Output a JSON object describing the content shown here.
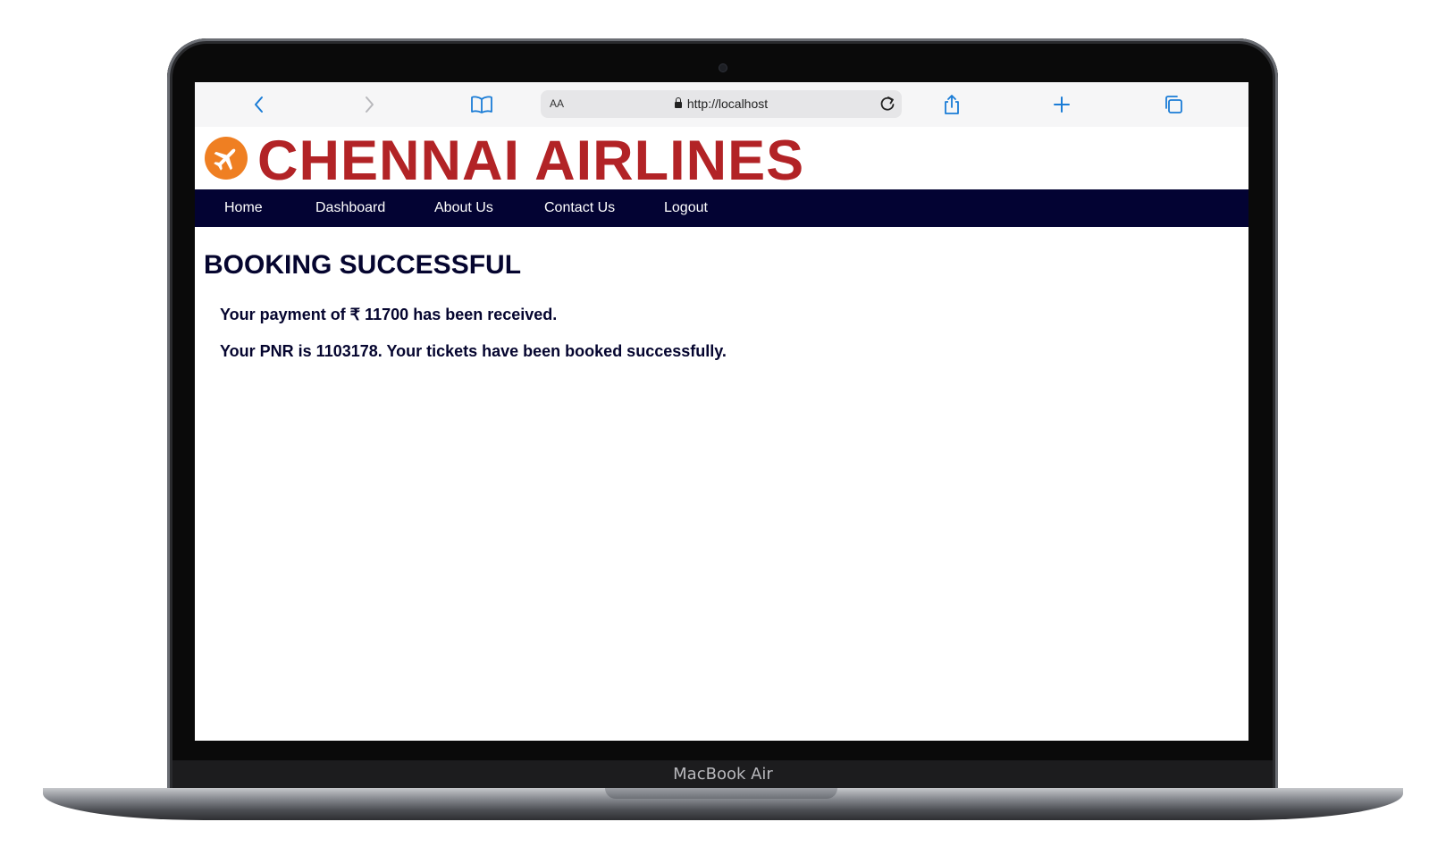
{
  "browser": {
    "text_size_label": "AA",
    "url": "http://localhost"
  },
  "site": {
    "title": "CHENNAI AIRLINES",
    "brand_color": "#b22326",
    "logo_color": "#ef7f22"
  },
  "nav": {
    "items": [
      {
        "label": "Home"
      },
      {
        "label": "Dashboard"
      },
      {
        "label": "About Us"
      },
      {
        "label": "Contact Us"
      },
      {
        "label": "Logout"
      }
    ],
    "background": "#030333"
  },
  "main": {
    "heading": "BOOKING SUCCESSFUL",
    "payment_message": "Your payment of ₹ 11700 has been received.",
    "pnr_message": "Your PNR is 1103178. Your tickets have been booked successfully."
  },
  "device": {
    "label": "MacBook Air"
  }
}
